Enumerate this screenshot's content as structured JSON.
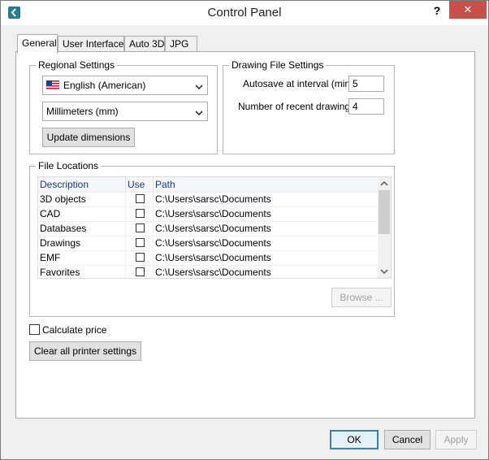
{
  "window": {
    "title": "Control Panel",
    "help_label": "?",
    "close_label": "✕"
  },
  "tabs": [
    {
      "label": "General",
      "active": true
    },
    {
      "label": "User Interface",
      "active": false
    },
    {
      "label": "Auto 3D",
      "active": false
    },
    {
      "label": "JPG",
      "active": false
    }
  ],
  "regional": {
    "label": "Regional Settings",
    "language": "English (American)",
    "units": "Millimeters (mm)",
    "update_button": "Update dimensions"
  },
  "drawing_file": {
    "label": "Drawing File Settings",
    "autosave_label": "Autosave at interval (min)",
    "autosave_value": "5",
    "recent_label": "Number of recent drawings",
    "recent_value": "4"
  },
  "file_locations": {
    "label": "File Locations",
    "columns": [
      "Description",
      "Use",
      "Path"
    ],
    "rows": [
      {
        "description": "3D objects",
        "use": false,
        "path": "C:\\Users\\sarsc\\Documents"
      },
      {
        "description": "CAD",
        "use": false,
        "path": "C:\\Users\\sarsc\\Documents"
      },
      {
        "description": "Databases",
        "use": false,
        "path": "C:\\Users\\sarsc\\Documents"
      },
      {
        "description": "Drawings",
        "use": false,
        "path": "C:\\Users\\sarsc\\Documents"
      },
      {
        "description": "EMF",
        "use": false,
        "path": "C:\\Users\\sarsc\\Documents"
      },
      {
        "description": "Favorites",
        "use": false,
        "path": "C:\\Users\\sarsc\\Documents"
      }
    ],
    "browse_button": "Browse ..."
  },
  "calculate_price": {
    "label": "Calculate price",
    "checked": false
  },
  "clear_printer_button": "Clear all printer settings",
  "footer": {
    "ok": "OK",
    "cancel": "Cancel",
    "apply": "Apply"
  },
  "colors": {
    "accent": "#3c7fb1",
    "close_red": "#c7504a",
    "header_text": "#1a3a8f"
  }
}
